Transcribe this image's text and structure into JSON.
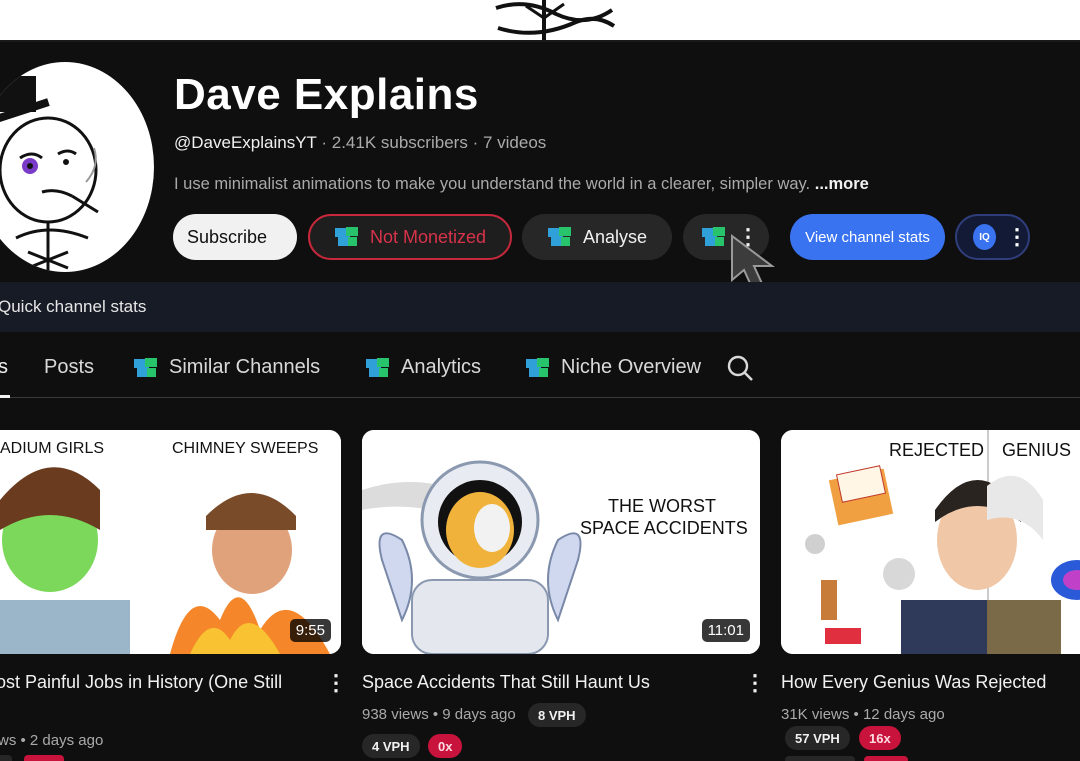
{
  "channel": {
    "name": "Dave Explains",
    "handle": "@DaveExplainsYT",
    "subscribers": "2.41K subscribers",
    "videos": "7 videos",
    "description": "I use minimalist animations to make you understand the world in a clearer, simpler way.",
    "more_label": "...more"
  },
  "buttons": {
    "subscribe": "Subscribe",
    "not_monetized": "Not Monetized",
    "analyse": "Analyse",
    "view_stats": "View channel stats",
    "iq_badge": "IQ"
  },
  "stats_bar": {
    "label": "Quick channel stats"
  },
  "tabs": [
    {
      "label": "s"
    },
    {
      "label": "Posts"
    },
    {
      "label": "Similar Channels"
    },
    {
      "label": "Analytics"
    },
    {
      "label": "Niche Overview"
    }
  ],
  "videos": [
    {
      "thumb_left": "ADIUM GIRLS",
      "thumb_right": "CHIMNEY SWEEPS",
      "duration": "9:55",
      "title": "ost Painful Jobs in History (One Still",
      "meta": "ws • 2 days ago"
    },
    {
      "thumb_text_1": "THE WORST",
      "thumb_text_2": "SPACE ACCIDENTS",
      "duration": "11:01",
      "title": "Space Accidents That Still Haunt Us",
      "views": "938 views",
      "age": "9 days ago",
      "vph": "8 VPH",
      "vph2": "4 VPH",
      "multiplier": "0x"
    },
    {
      "thumb_left": "REJECTED",
      "thumb_right": "GENIUS",
      "title": "How Every Genius Was Rejected",
      "views": "31K views",
      "age": "12 days ago",
      "vph": "57 VPH",
      "multiplier": "16x"
    }
  ],
  "colors": {
    "background": "#0f0f0f",
    "accent_blue": "#3a73f0",
    "monetized_red": "#c8283c"
  }
}
